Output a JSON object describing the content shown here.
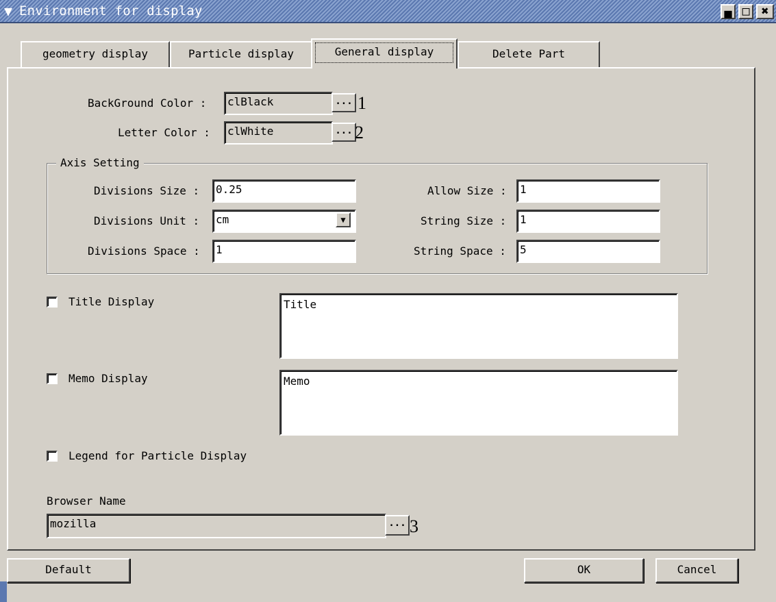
{
  "window": {
    "title": "Environment for display",
    "menu_icon": "chevron-down-icon",
    "minimize_icon": "minimize-icon",
    "maximize_icon": "maximize-icon",
    "close_icon": "close-icon"
  },
  "tabs": [
    {
      "label": "geometry display"
    },
    {
      "label": "Particle display"
    },
    {
      "label": "General display",
      "active": true
    },
    {
      "label": "Delete Part"
    }
  ],
  "general": {
    "background_color": {
      "label": "BackGround Color :",
      "value": "clBlack",
      "button": "...",
      "annotation": "1"
    },
    "letter_color": {
      "label": "Letter Color :",
      "value": "clWhite",
      "button": "...",
      "annotation": "2"
    },
    "axis": {
      "legend": "Axis Setting",
      "divisions_size": {
        "label": "Divisions Size :",
        "value": "0.25"
      },
      "divisions_unit": {
        "label": "Divisions Unit :",
        "value": "cm"
      },
      "divisions_space": {
        "label": "Divisions Space :",
        "value": "1"
      },
      "allow_size": {
        "label": "Allow Size :",
        "value": "1"
      },
      "string_size": {
        "label": "String Size :",
        "value": "1"
      },
      "string_space": {
        "label": "String Space :",
        "value": "5"
      }
    },
    "title_display": {
      "label": "Title Display",
      "checked": false,
      "text": "Title"
    },
    "memo_display": {
      "label": "Memo Display",
      "checked": false,
      "text": "Memo"
    },
    "legend_display": {
      "label": "Legend for Particle Display",
      "checked": false
    },
    "browser": {
      "label": "Browser Name",
      "value": "mozilla",
      "button": "...",
      "annotation": "3"
    }
  },
  "buttons": {
    "default": "Default",
    "ok": "OK",
    "cancel": "Cancel"
  }
}
